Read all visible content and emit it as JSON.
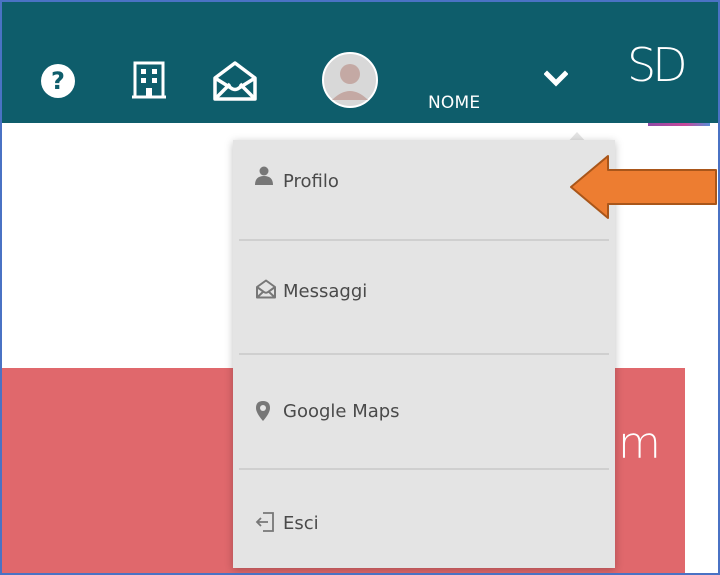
{
  "header": {
    "user_name": "NOME",
    "logo_text": "SD",
    "icons": [
      "help-icon",
      "building-icon",
      "mail-icon",
      "avatar",
      "chevron-down-icon"
    ],
    "background_color": "#0e5d6b"
  },
  "dropdown": {
    "items": [
      {
        "label": "Profilo",
        "icon": "user-icon"
      },
      {
        "label": "Messaggi",
        "icon": "mail-open-icon"
      },
      {
        "label": "Google Maps",
        "icon": "map-marker-icon"
      },
      {
        "label": "Esci",
        "icon": "logout-icon"
      }
    ],
    "background_color": "#e4e4e4"
  },
  "annotation": {
    "arrow_color": "#ed7d31",
    "points_to": "Profilo"
  },
  "background_panel": {
    "color": "#e0686c",
    "partial_text": "m"
  }
}
